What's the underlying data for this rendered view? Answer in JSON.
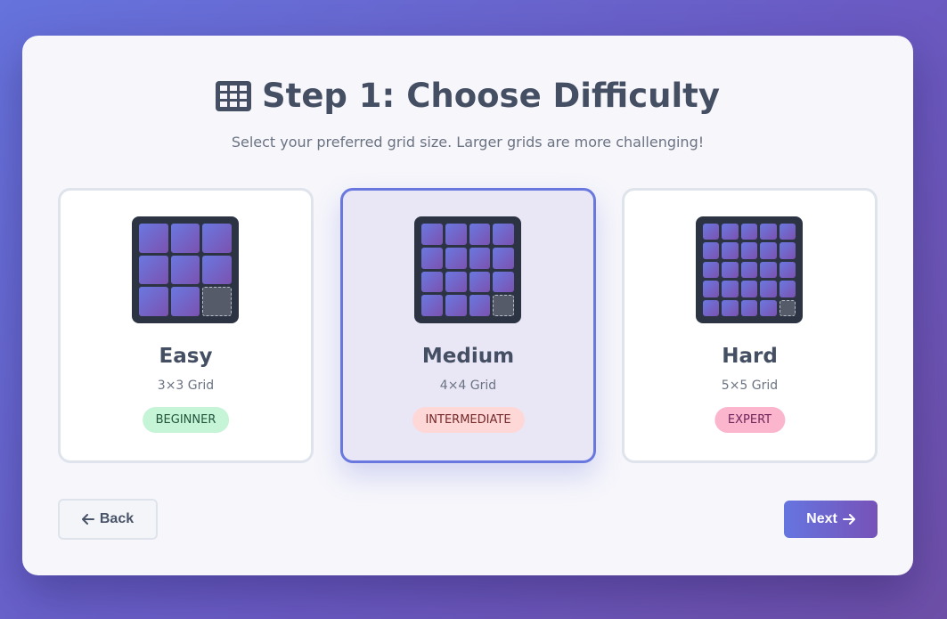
{
  "header": {
    "icon": "grid-icon",
    "title": "Step 1: Choose Difficulty",
    "subtitle": "Select your preferred grid size. Larger grids are more challenging!"
  },
  "options": [
    {
      "name": "Easy",
      "grid": "3×3 Grid",
      "badge": "BEGINNER",
      "size": 3,
      "selected": false,
      "badge_color": "#c6f4d6"
    },
    {
      "name": "Medium",
      "grid": "4×4 Grid",
      "badge": "INTERMEDIATE",
      "size": 4,
      "selected": true,
      "badge_color": "#fed7d7"
    },
    {
      "name": "Hard",
      "grid": "5×5 Grid",
      "badge": "EXPERT",
      "size": 5,
      "selected": false,
      "badge_color": "#fbb6ce"
    }
  ],
  "nav": {
    "back_label": "Back",
    "back_icon": "arrow-left-icon",
    "next_label": "Next",
    "next_icon": "arrow-right-icon"
  },
  "colors": {
    "accent": "#6978df",
    "accent_end": "#7652b8",
    "tile_start": "#6a78e0",
    "tile_end": "#7b52b0",
    "preview_bg": "#2c3444"
  }
}
